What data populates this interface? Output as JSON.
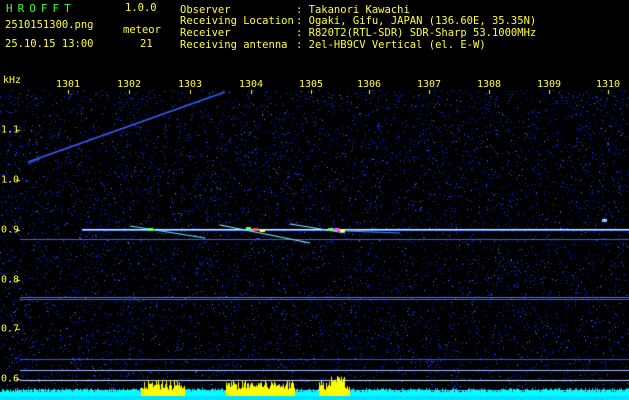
{
  "app": {
    "title": "HROFFT",
    "version": "1.0.0",
    "filename": "2510151300.png",
    "datetime": "25.10.15 13:00",
    "meteor_label": "meteor",
    "meteor_count": "21"
  },
  "info": {
    "observer_label": "Observer",
    "observer_value": ": Takanori Kawachi",
    "location_label": "Receiving Location",
    "location_value": ": Ogaki, Gifu, JAPAN (136.60E, 35.35N)",
    "receiver_label": "Receiver",
    "receiver_value": ": R820T2(RTL-SDR) SDR-Sharp 53.1000MHz",
    "antenna_label": "Receiving antenna",
    "antenna_value": ": 2el-HB9CV Vertical (el. E-W)"
  },
  "axes": {
    "y_unit": "kHz",
    "x_ticks": [
      "1301",
      "1302",
      "1303",
      "1304",
      "1305",
      "1306",
      "1307",
      "1308",
      "1309",
      "1310"
    ],
    "y_ticks": [
      "1.1",
      "1.0",
      "0.9",
      "0.8",
      "0.7",
      "0.6"
    ]
  },
  "colors": {
    "text_yellow": "#ffff33",
    "text_green": "#33ff33",
    "background": "#000000",
    "noise_blue": "#1f3cff",
    "carrier_cyan": "#c8ffff",
    "signal_level_cyan": "#00ffff",
    "signal_level_yellow": "#ffff00"
  }
}
